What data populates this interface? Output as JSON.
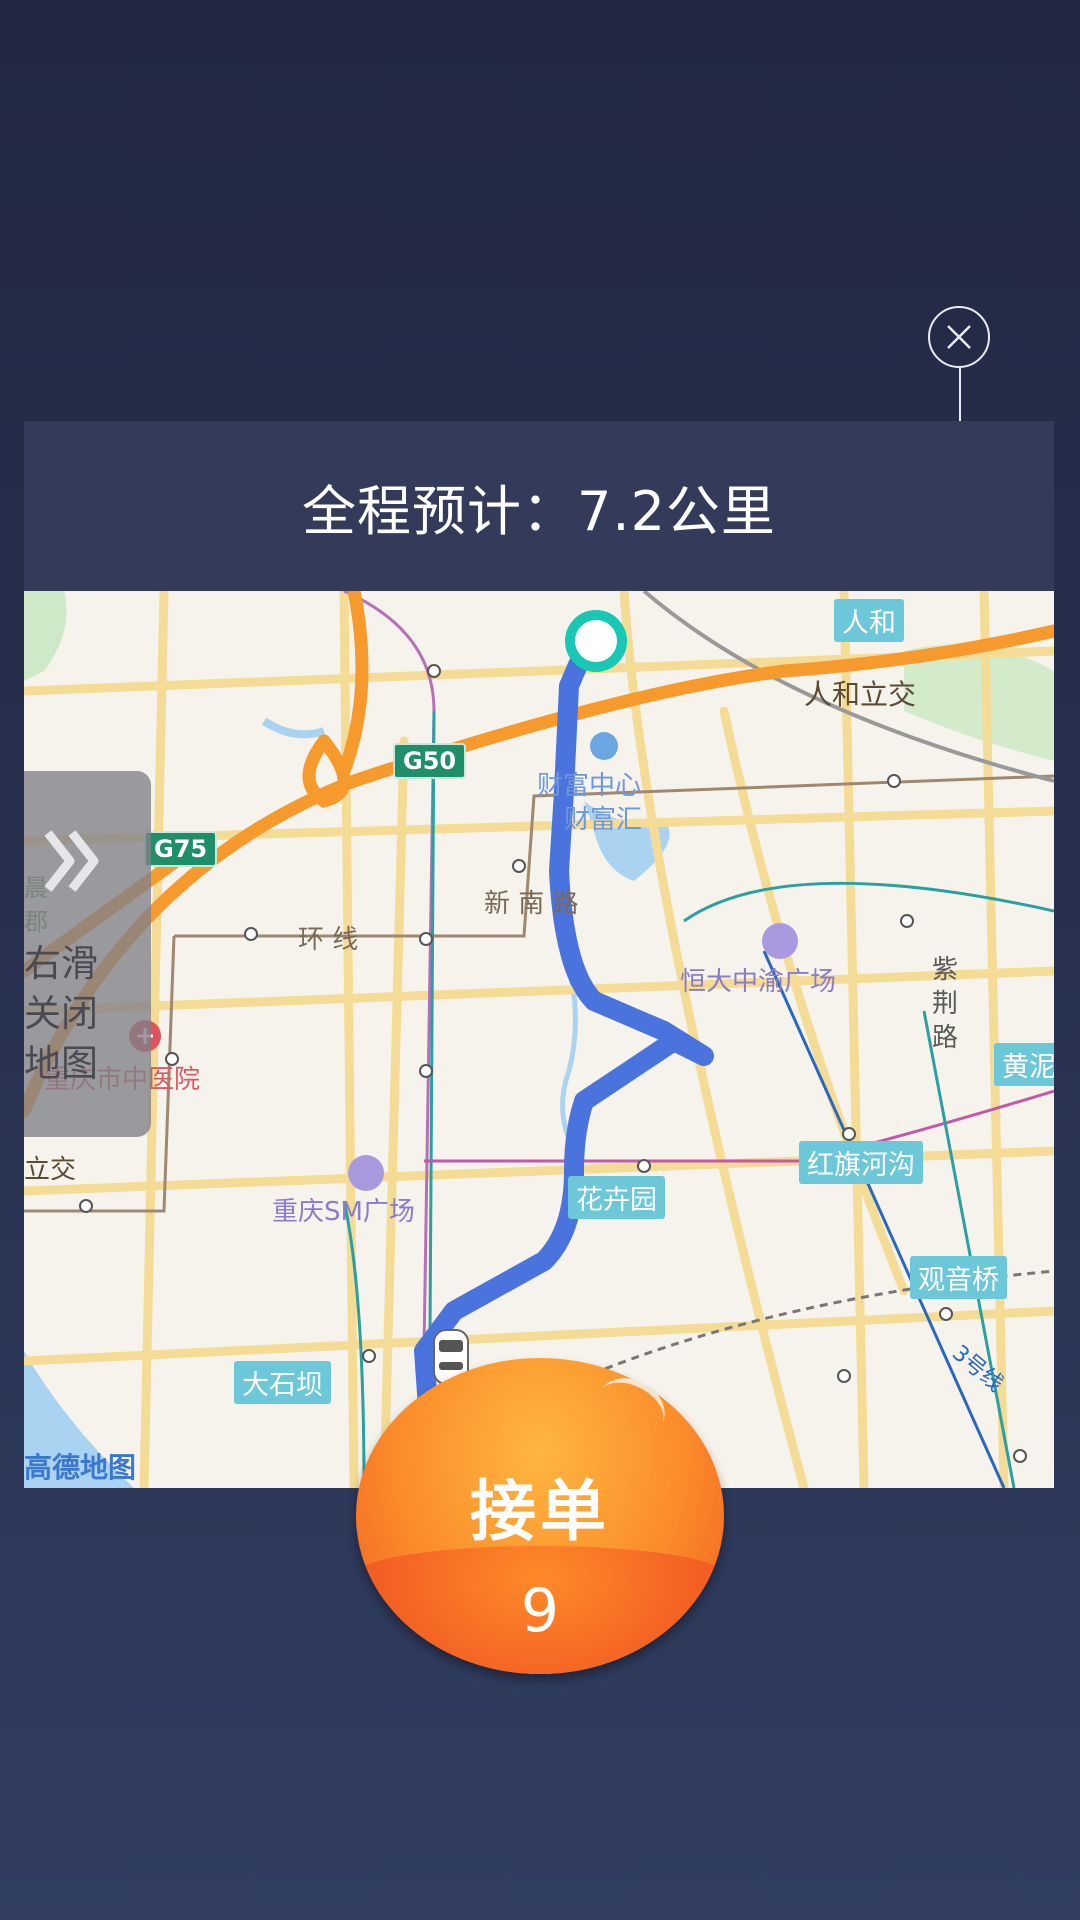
{
  "dialog": {
    "title": "全程预计：7.2公里"
  },
  "slide_panel": {
    "hint": "右滑关闭地图"
  },
  "accept": {
    "label": "接单",
    "count": "9"
  },
  "map": {
    "labels": {
      "renhe": "人和",
      "renhe_interchange": "人和立交",
      "g50": "G50",
      "g75": "G75",
      "caifu_center": "财富中心",
      "caifu_hui": "财富汇",
      "xinnan_road": "新 南 路",
      "ring_line": "环 线",
      "evergrande_plaza": "恒大中渝广场",
      "zijing_road": "紫荆路",
      "huangni": "黄泥",
      "tcm_hospital": "重庆市中医院",
      "hongqihegou": "红旗河沟",
      "interchange_left": "立交",
      "sm_plaza": "重庆SM广场",
      "huahuiyuan": "花卉园",
      "guanyinqiao": "观音桥",
      "dashiba": "大石坝",
      "amap_logo": "高德地图",
      "line_partial": "3号线",
      "left_edge_text": "晨郡"
    }
  },
  "colors": {
    "route": "#4a73dd",
    "origin_marker": "#18c8b4",
    "button_orange": "#fb8c2a"
  },
  "icons": {
    "close": "close-icon",
    "slide": "double-chevron-right-icon",
    "car": "car-icon"
  }
}
